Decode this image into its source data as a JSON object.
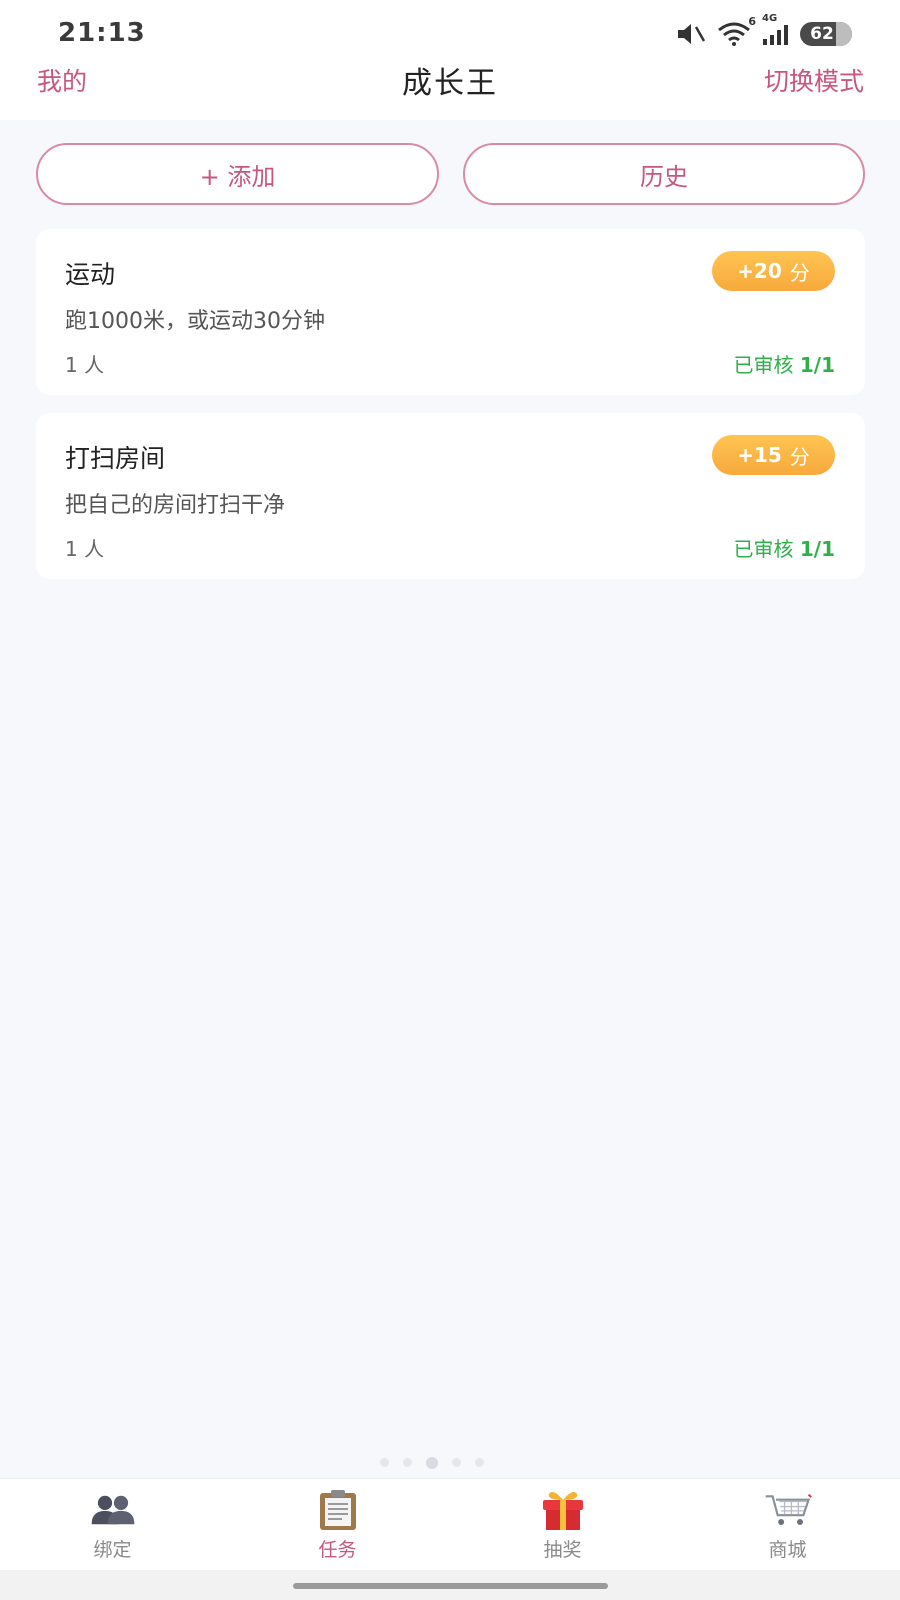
{
  "status_bar": {
    "time": "21:13",
    "network_label": "4G",
    "wifi_label": "6",
    "battery": "62"
  },
  "header": {
    "left_link": "我的",
    "title": "成长王",
    "right_link": "切换模式"
  },
  "actions": {
    "add_label": "+ 添加",
    "history_label": "历史"
  },
  "tasks": [
    {
      "title": "运动",
      "points": "+20",
      "points_unit": "分",
      "description": "跑1000米，或运动30分钟",
      "people": "1 人",
      "status_label": "已审核",
      "status_count": "1/1"
    },
    {
      "title": "打扫房间",
      "points": "+15",
      "points_unit": "分",
      "description": "把自己的房间打扫干净",
      "people": "1 人",
      "status_label": "已审核",
      "status_count": "1/1"
    }
  ],
  "tabbar": {
    "items": [
      {
        "label": "绑定",
        "icon": "users-icon",
        "active": false
      },
      {
        "label": "任务",
        "icon": "clipboard-icon",
        "active": true
      },
      {
        "label": "抽奖",
        "icon": "gift-icon",
        "active": false
      },
      {
        "label": "商城",
        "icon": "shopping-cart-icon",
        "active": false
      }
    ]
  },
  "colors": {
    "accent": "#c9577c",
    "approved": "#2fb14a",
    "badge": "#f7a93c"
  }
}
